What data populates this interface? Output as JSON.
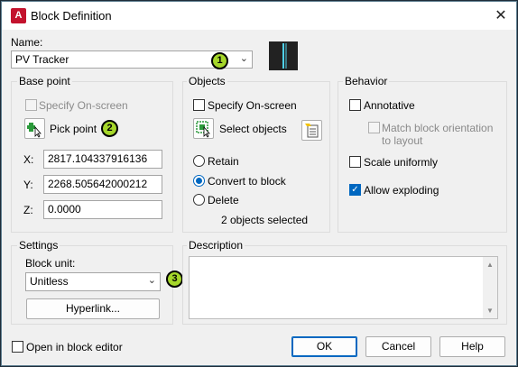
{
  "window": {
    "title": "Block Definition",
    "app_icon": "A"
  },
  "name": {
    "label": "Name:",
    "value": "PV Tracker"
  },
  "base_point": {
    "title": "Base point",
    "specify_onscreen": "Specify On-screen",
    "pick_point": "Pick point",
    "x_label": "X:",
    "x_value": "2817.104337916136",
    "y_label": "Y:",
    "y_value": "2268.505642000212",
    "z_label": "Z:",
    "z_value": "0.0000"
  },
  "objects": {
    "title": "Objects",
    "specify_onscreen": "Specify On-screen",
    "select_objects": "Select objects",
    "retain": "Retain",
    "convert": "Convert to block",
    "delete": "Delete",
    "status": "2 objects selected"
  },
  "behavior": {
    "title": "Behavior",
    "annotative": "Annotative",
    "match_line1": "Match block orientation",
    "match_line2": "to layout",
    "scale_uniformly": "Scale uniformly",
    "allow_exploding": "Allow exploding"
  },
  "settings": {
    "title": "Settings",
    "block_unit_label": "Block unit:",
    "block_unit_value": "Unitless",
    "hyperlink": "Hyperlink..."
  },
  "description": {
    "title": "Description"
  },
  "footer": {
    "open_in_editor": "Open in block editor",
    "ok": "OK",
    "cancel": "Cancel",
    "help": "Help"
  },
  "markers": {
    "m1": "1",
    "m2": "2",
    "m3": "3"
  },
  "colors": {
    "accent": "#0067c0",
    "marker": "#a5d62a",
    "app_icon": "#c3122d"
  }
}
